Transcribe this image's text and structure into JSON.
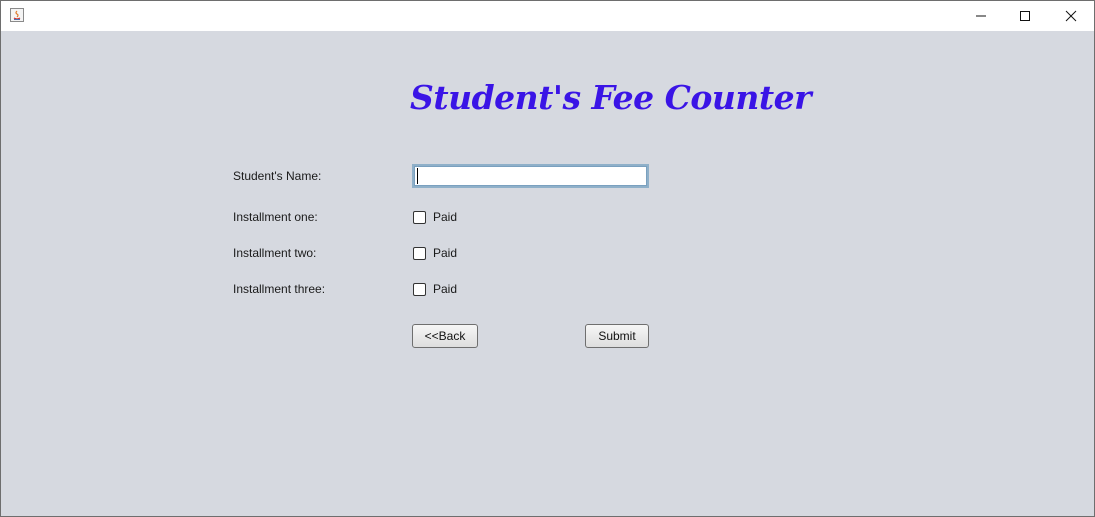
{
  "window": {
    "icon": "java-app-icon",
    "controls": {
      "minimize": "minimize-icon",
      "maximize": "maximize-icon",
      "close": "close-icon"
    }
  },
  "form": {
    "heading": "Student's Fee Counter",
    "heading_color": "#3a14e6",
    "background_color": "#d6d9e0",
    "name_label": "Student's Name:",
    "name_value": "",
    "installments": [
      {
        "label": "Installment one:",
        "checkbox_label": "Paid",
        "checked": false
      },
      {
        "label": "Installment two:",
        "checkbox_label": "Paid",
        "checked": false
      },
      {
        "label": "Installment three:",
        "checkbox_label": "Paid",
        "checked": false
      }
    ],
    "back_label": "<<Back",
    "submit_label": "Submit"
  }
}
